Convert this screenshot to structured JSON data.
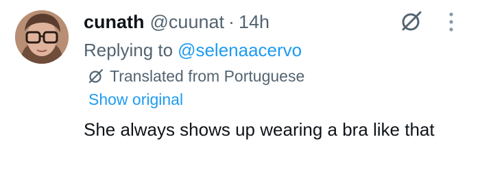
{
  "tweet": {
    "display_name": "cunath",
    "handle": "@cuunat",
    "separator": "·",
    "time": "14h",
    "replying_prefix": "Replying to",
    "replying_handle": "@selenaacervo",
    "translated_label": "Translated from Portuguese",
    "show_original_label": "Show original",
    "text": "She always shows up wearing a bra like that"
  },
  "icons": {
    "grok": "grok-icon",
    "more": "more-options-icon",
    "translate": "translate-icon"
  },
  "colors": {
    "primary_text": "#0f1419",
    "secondary_text": "#536471",
    "link": "#1d9bf0",
    "background": "#ffffff"
  }
}
